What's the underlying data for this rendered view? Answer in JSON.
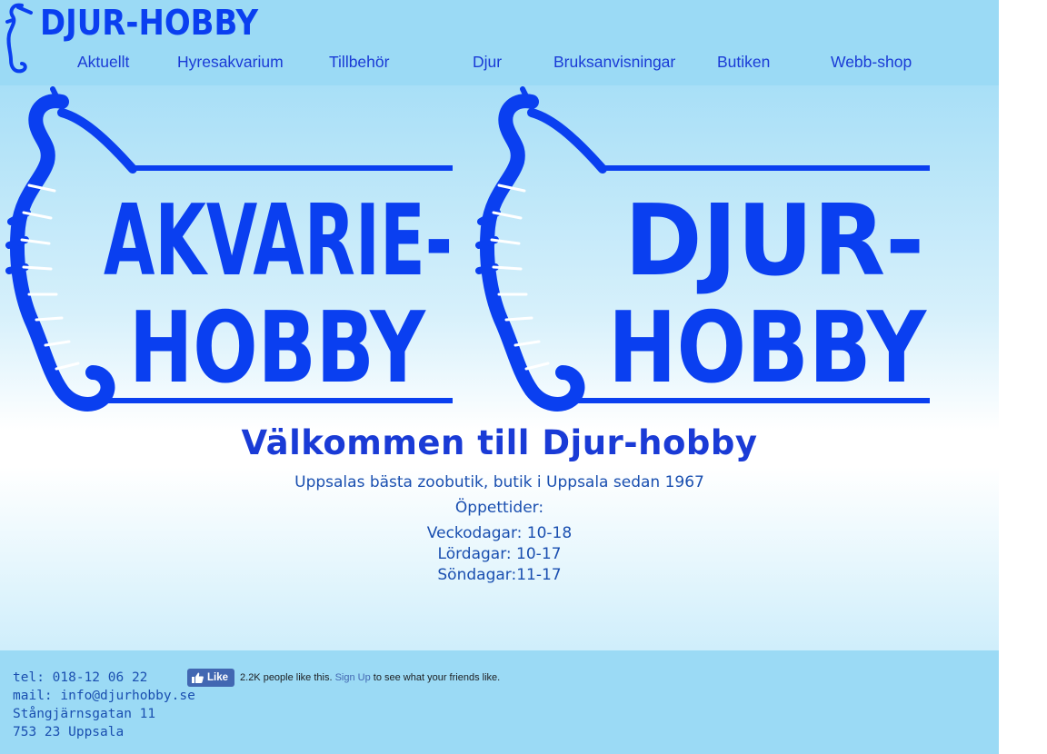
{
  "header": {
    "logo_text": "DJUR-HOBBY",
    "nav": [
      {
        "label": "Aktuellt"
      },
      {
        "label": "Hyresakvarium"
      },
      {
        "label": "Tillbehör"
      },
      {
        "label": "Djur"
      },
      {
        "label": "Bruksanvisningar"
      },
      {
        "label": "Butiken"
      },
      {
        "label": "Webb-shop"
      }
    ]
  },
  "banner": {
    "left_line1": "AKVARIE-",
    "left_line2": "HOBBY",
    "right_line1": "DJUR-",
    "right_line2": "HOBBY",
    "icon": "seahorse-icon"
  },
  "main": {
    "title": "Välkommen till Djur-hobby",
    "tagline": "Uppsalas bästa zoobutik, butik i Uppsala sedan 1967",
    "hours_heading": "Öppettider:",
    "hours": [
      "Veckodagar: 10-18",
      "Lördagar: 10-17",
      "Söndagar:11-17"
    ]
  },
  "footer": {
    "tel": "tel: 018-12 06 22",
    "mail_prefix": "mail: ",
    "mail": "info@djurhobby.se",
    "street": "Stångjärnsgatan 11",
    "city": "753 23 Uppsala",
    "fb": {
      "like_label": "Like",
      "count_text": "2.2K people like this.",
      "signup_label": "Sign Up",
      "suffix_text": " to see what your friends like."
    }
  },
  "colors": {
    "header_bg": "#9bdaf5",
    "brand_blue": "#1a3bd6",
    "logo_blue": "#0a3ff0",
    "fb_blue": "#4267b2"
  }
}
